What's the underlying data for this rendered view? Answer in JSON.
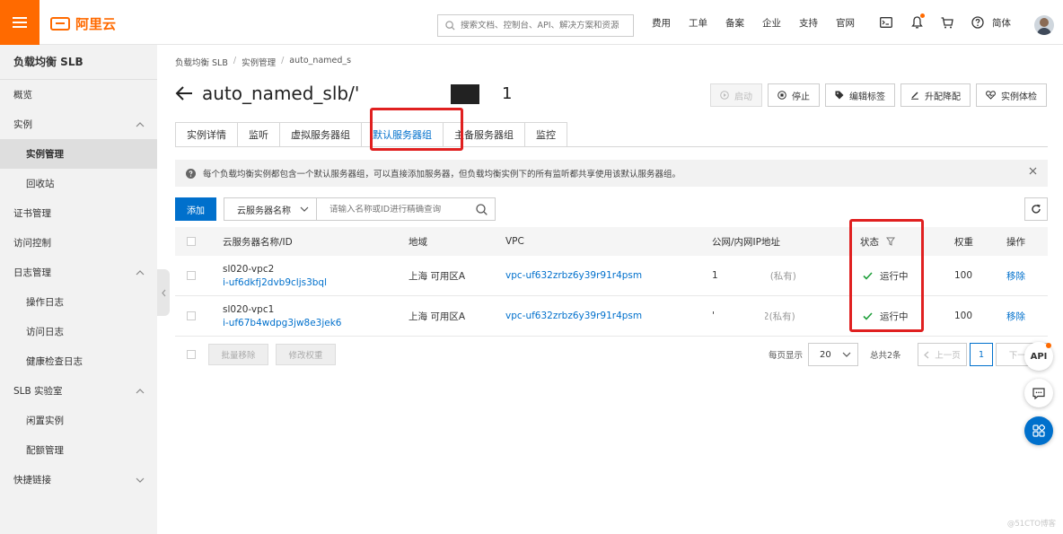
{
  "topbar": {
    "logo_text": "阿里云",
    "search_placeholder": "搜索文档、控制台、API、解决方案和资源",
    "links": [
      "费用",
      "工单",
      "备案",
      "企业",
      "支持",
      "官网"
    ],
    "icons": [
      "terminal-icon",
      "bell-icon",
      "cart-icon",
      "help-icon"
    ],
    "language": "简体"
  },
  "sidebar": {
    "title": "负载均衡 SLB",
    "items": [
      {
        "label": "概览",
        "level": 1,
        "chevron": ""
      },
      {
        "label": "实例",
        "level": 1,
        "chevron": "up"
      },
      {
        "label": "实例管理",
        "level": 2,
        "active": true
      },
      {
        "label": "回收站",
        "level": 2
      },
      {
        "label": "证书管理",
        "level": 1
      },
      {
        "label": "访问控制",
        "level": 1
      },
      {
        "label": "日志管理",
        "level": 1,
        "chevron": "up"
      },
      {
        "label": "操作日志",
        "level": 2
      },
      {
        "label": "访问日志",
        "level": 2
      },
      {
        "label": "健康检查日志",
        "level": 2
      },
      {
        "label": "SLB 实验室",
        "level": 1,
        "chevron": "up"
      },
      {
        "label": "闲置实例",
        "level": 2
      },
      {
        "label": "配额管理",
        "level": 2
      },
      {
        "label": "快捷链接",
        "level": 1,
        "chevron": "down"
      }
    ]
  },
  "breadcrumb": [
    "负载均衡 SLB",
    "实例管理",
    "auto_named_s"
  ],
  "page": {
    "title": "auto_named_slb/'",
    "title_tail": "1"
  },
  "actions": {
    "start": "启动",
    "stop": "停止",
    "edit_tags": "编辑标签",
    "upgrade": "升配降配",
    "inspect": "实例体检"
  },
  "tabs": [
    "实例详情",
    "监听",
    "虚拟服务器组",
    "默认服务器组",
    "主备服务器组",
    "监控"
  ],
  "active_tab": 3,
  "notice": "每个负载均衡实例都包含一个默认服务器组，可以直接添加服务器，但负载均衡实例下的所有监听都共享使用该默认服务器组。",
  "toolbar": {
    "add": "添加",
    "filter_select": "云服务器名称",
    "search_placeholder": "请输入名称或ID进行精确查询"
  },
  "table": {
    "headers": [
      "云服务器名称/ID",
      "地域",
      "VPC",
      "公网/内网IP地址",
      "状态",
      "权重",
      "操作"
    ],
    "rows": [
      {
        "name": "sl020-vpc2",
        "id": "i-uf6dkfj2dvb9cljs3bql",
        "region": "上海 可用区A",
        "vpc": "vpc-uf632zrbz6y39r91r4psm",
        "ip_prefix": "1\t",
        "ip_suffix": "(私有)",
        "status": "运行中",
        "weight": "100",
        "action": "移除"
      },
      {
        "name": "sl020-vpc1",
        "id": "i-uf67b4wdpg3jw8e3jek6",
        "region": "上海 可用区A",
        "vpc": "vpc-uf632zrbz6y39r91r4psm",
        "ip_prefix": "'",
        "ip_suffix": "2(私有)",
        "status": "运行中",
        "weight": "100",
        "action": "移除"
      }
    ]
  },
  "footer": {
    "batch_remove": "批量移除",
    "edit_weight": "修改权重",
    "per_page_label": "每页显示",
    "per_page": "20",
    "total": "总共2条",
    "prev": "上一页",
    "current_page": "1",
    "next": "下一页"
  },
  "float_buttons": {
    "api": "API"
  },
  "watermark": "@51CTO博客",
  "colors": {
    "brand": "#ff6a00",
    "primary": "#0070cc",
    "success": "#1e9f3a",
    "annotation": "#e02020"
  }
}
